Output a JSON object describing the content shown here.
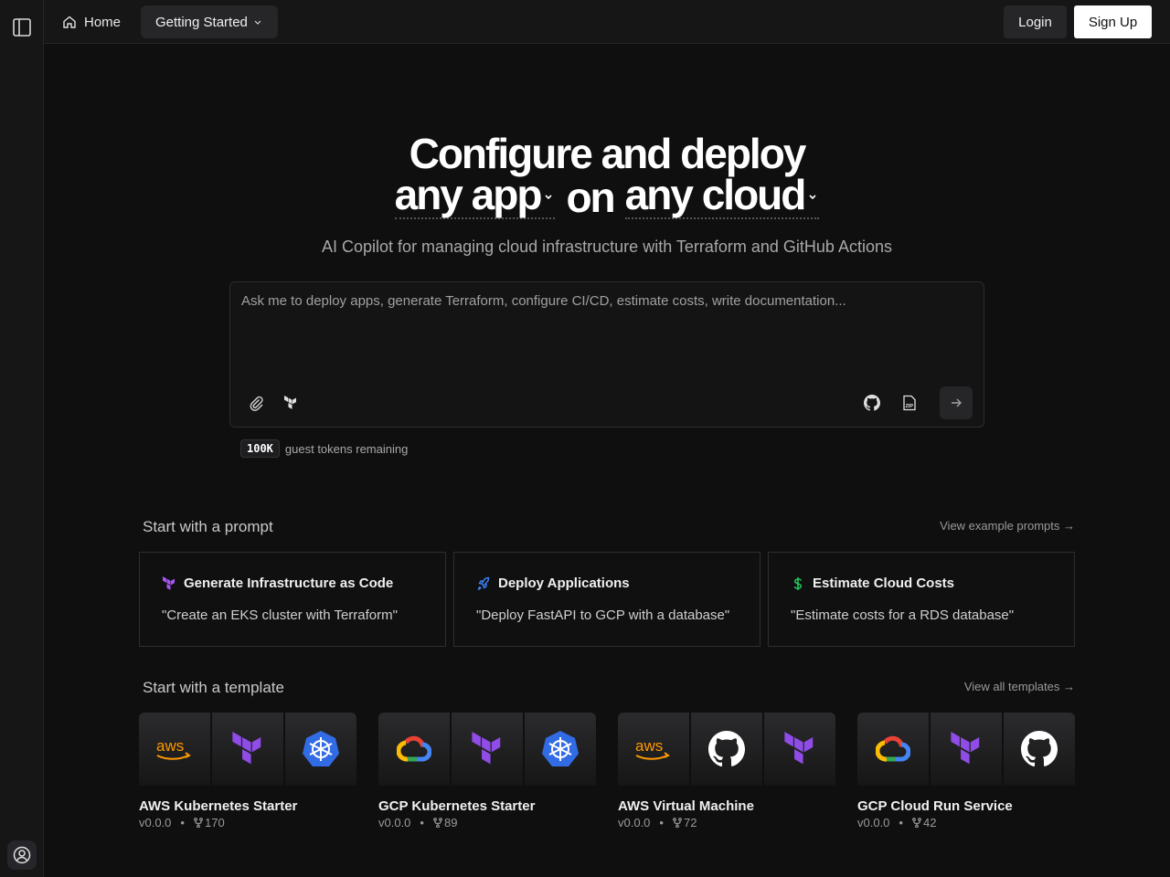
{
  "nav": {
    "home": "Home",
    "getting_started": "Getting Started",
    "login": "Login",
    "signup": "Sign Up"
  },
  "hero": {
    "line1": "Configure and deploy",
    "any_app": "any app",
    "on": "on",
    "any_cloud": "any cloud"
  },
  "subtitle": "AI Copilot for managing cloud infrastructure with Terraform and GitHub Actions",
  "prompt": {
    "placeholder": "Ask me to deploy apps, generate Terraform, configure CI/CD, estimate costs, write documentation..."
  },
  "tokens": {
    "count": "100K",
    "label": "guest tokens remaining"
  },
  "prompt_section": {
    "title": "Start with a prompt",
    "link": "View example prompts →",
    "cards": [
      {
        "title": "Generate Infrastructure as Code",
        "example": "\"Create an EKS cluster with Terraform\"",
        "icon": "terraform-icon",
        "icon_color": "#a855f7"
      },
      {
        "title": "Deploy Applications",
        "example": "\"Deploy FastAPI to GCP with a database\"",
        "icon": "rocket-icon",
        "icon_color": "#3b82f6"
      },
      {
        "title": "Estimate Cloud Costs",
        "example": "\"Estimate costs for a RDS database\"",
        "icon": "dollar-icon",
        "icon_color": "#22c55e"
      }
    ]
  },
  "template_section": {
    "title": "Start with a template",
    "link": "View all templates →",
    "templates": [
      {
        "name": "AWS Kubernetes Starter",
        "version": "v0.0.0",
        "forks": "170",
        "icons": [
          "aws-icon",
          "terraform-icon",
          "kubernetes-icon"
        ]
      },
      {
        "name": "GCP Kubernetes Starter",
        "version": "v0.0.0",
        "forks": "89",
        "icons": [
          "gcp-icon",
          "terraform-icon",
          "kubernetes-icon"
        ]
      },
      {
        "name": "AWS Virtual Machine",
        "version": "v0.0.0",
        "forks": "72",
        "icons": [
          "aws-icon",
          "github-icon",
          "terraform-icon"
        ]
      },
      {
        "name": "GCP Cloud Run Service",
        "version": "v0.0.0",
        "forks": "42",
        "icons": [
          "gcp-icon",
          "terraform-icon",
          "github-icon"
        ]
      }
    ]
  },
  "colors": {
    "terraform": "#8f4ce6",
    "kubernetes": "#326ce5",
    "aws": "#ff9900",
    "background": "#0f0f10"
  }
}
